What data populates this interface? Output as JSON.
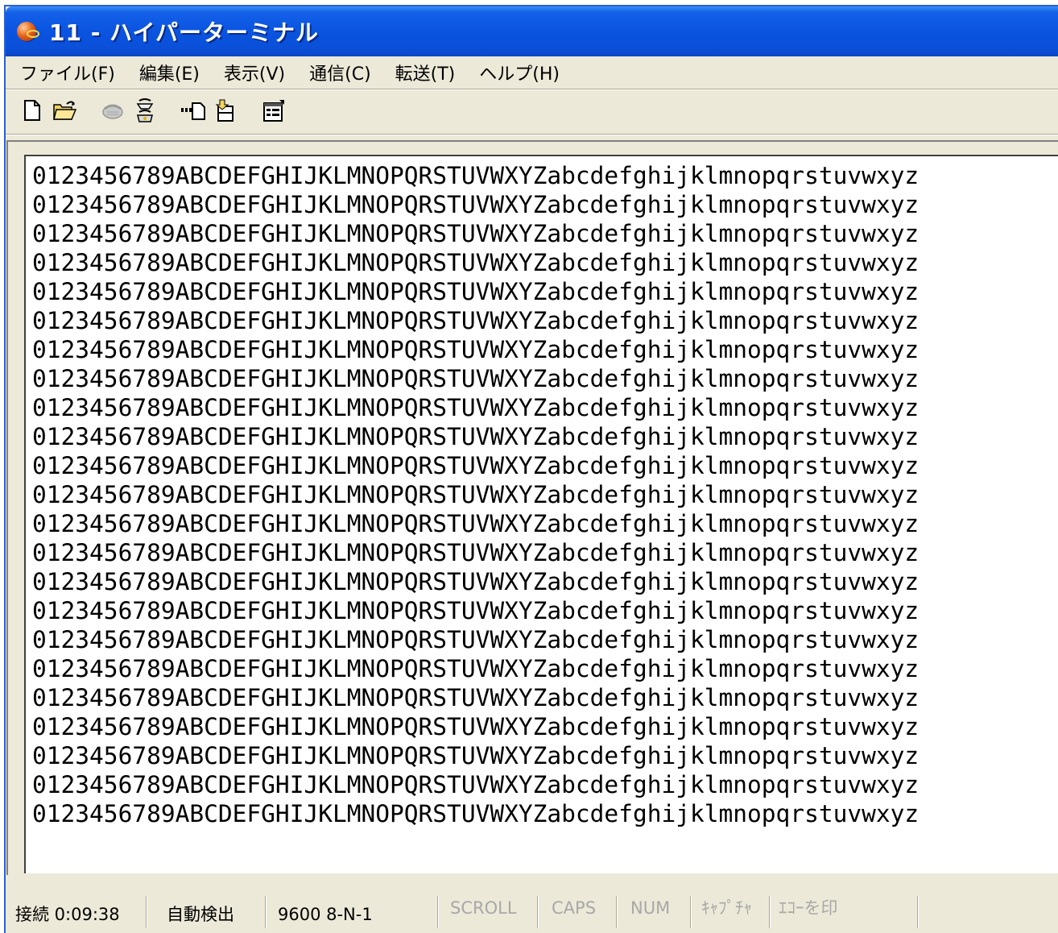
{
  "window": {
    "title": "11 - ハイパーターミナル",
    "title_bar_color": "#0a54e0"
  },
  "menu": [
    "ファイル(F)",
    "編集(E)",
    "表示(V)",
    "通信(C)",
    "転送(T)",
    "ヘルプ(H)"
  ],
  "toolbar": {
    "buttons": [
      "new-connection-icon",
      "open-folder-icon",
      "call-icon",
      "disconnect-icon",
      "send-file-icon",
      "receive-file-icon",
      "properties-icon"
    ]
  },
  "terminal": {
    "lines": [
      "0123456789ABCDEFGHIJKLMNOPQRSTUVWXYZabcdefghijklmnopqrstuvwxyz",
      "0123456789ABCDEFGHIJKLMNOPQRSTUVWXYZabcdefghijklmnopqrstuvwxyz",
      "0123456789ABCDEFGHIJKLMNOPQRSTUVWXYZabcdefghijklmnopqrstuvwxyz",
      "0123456789ABCDEFGHIJKLMNOPQRSTUVWXYZabcdefghijklmnopqrstuvwxyz",
      "0123456789ABCDEFGHIJKLMNOPQRSTUVWXYZabcdefghijklmnopqrstuvwxyz",
      "0123456789ABCDEFGHIJKLMNOPQRSTUVWXYZabcdefghijklmnopqrstuvwxyz",
      "0123456789ABCDEFGHIJKLMNOPQRSTUVWXYZabcdefghijklmnopqrstuvwxyz",
      "0123456789ABCDEFGHIJKLMNOPQRSTUVWXYZabcdefghijklmnopqrstuvwxyz",
      "0123456789ABCDEFGHIJKLMNOPQRSTUVWXYZabcdefghijklmnopqrstuvwxyz",
      "0123456789ABCDEFGHIJKLMNOPQRSTUVWXYZabcdefghijklmnopqrstuvwxyz",
      "0123456789ABCDEFGHIJKLMNOPQRSTUVWXYZabcdefghijklmnopqrstuvwxyz",
      "0123456789ABCDEFGHIJKLMNOPQRSTUVWXYZabcdefghijklmnopqrstuvwxyz",
      "0123456789ABCDEFGHIJKLMNOPQRSTUVWXYZabcdefghijklmnopqrstuvwxyz",
      "0123456789ABCDEFGHIJKLMNOPQRSTUVWXYZabcdefghijklmnopqrstuvwxyz",
      "0123456789ABCDEFGHIJKLMNOPQRSTUVWXYZabcdefghijklmnopqrstuvwxyz",
      "0123456789ABCDEFGHIJKLMNOPQRSTUVWXYZabcdefghijklmnopqrstuvwxyz",
      "0123456789ABCDEFGHIJKLMNOPQRSTUVWXYZabcdefghijklmnopqrstuvwxyz",
      "0123456789ABCDEFGHIJKLMNOPQRSTUVWXYZabcdefghijklmnopqrstuvwxyz",
      "0123456789ABCDEFGHIJKLMNOPQRSTUVWXYZabcdefghijklmnopqrstuvwxyz",
      "0123456789ABCDEFGHIJKLMNOPQRSTUVWXYZabcdefghijklmnopqrstuvwxyz",
      "0123456789ABCDEFGHIJKLMNOPQRSTUVWXYZabcdefghijklmnopqrstuvwxyz",
      "0123456789ABCDEFGHIJKLMNOPQRSTUVWXYZabcdefghijklmnopqrstuvwxyz",
      "0123456789ABCDEFGHIJKLMNOPQRSTUVWXYZabcdefghijklmnopqrstuvwxyz"
    ]
  },
  "status": {
    "connection": "接続 0:09:38",
    "detect": "自動検出",
    "port_settings": "9600 8-N-1",
    "scroll": "SCROLL",
    "caps": "CAPS",
    "num": "NUM",
    "capture": "ｷｬﾌﾟﾁｬ",
    "echo": "ｴｺｰを印"
  }
}
